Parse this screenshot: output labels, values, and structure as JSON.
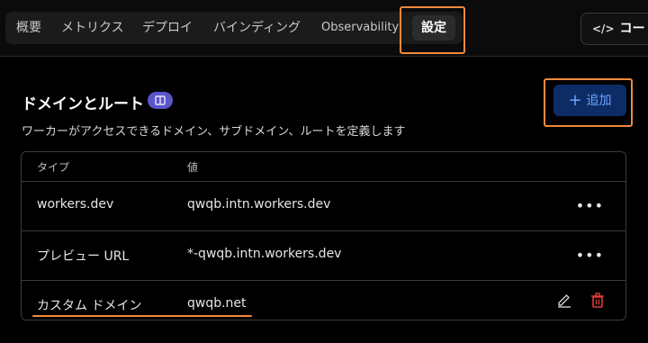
{
  "tabs": [
    {
      "label": "概要"
    },
    {
      "label": "メトリクス"
    },
    {
      "label": "デプロイ"
    },
    {
      "label": "バインディング"
    },
    {
      "label": "Observability"
    },
    {
      "label": "設定",
      "active": true
    }
  ],
  "header": {
    "code_button_label": "コード"
  },
  "section": {
    "title": "ドメインとルート",
    "description": "ワーカーがアクセスできるドメイン、サブドメイン、ルートを定義します",
    "add_button_label": "追加"
  },
  "table": {
    "columns": [
      "タイプ",
      "値"
    ],
    "rows": [
      {
        "type": "workers.dev",
        "value": "qwqb.intn.workers.dev",
        "actions": "more"
      },
      {
        "type": "プレビュー URL",
        "value": "*-qwqb.intn.workers.dev",
        "actions": "more"
      },
      {
        "type": "カスタム ドメイン",
        "value": "qwqb.net",
        "actions": "edit-delete"
      }
    ]
  },
  "colors": {
    "highlight": "#f08a3c",
    "accent": "#6fa3ff",
    "delete": "#e03c3c",
    "badge": "#5b55c9"
  }
}
